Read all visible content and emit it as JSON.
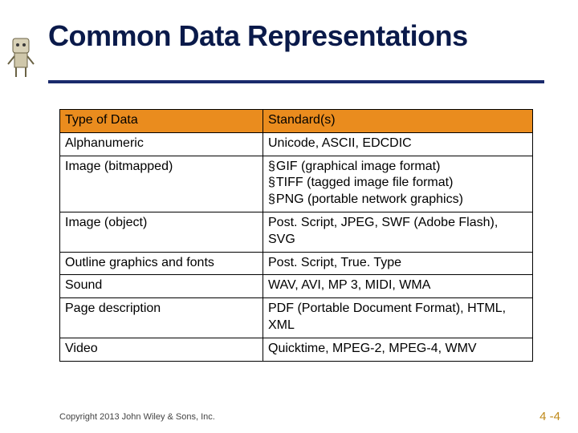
{
  "title": "Common Data Representations",
  "table": {
    "headers": {
      "col1": "Type of Data",
      "col2": "Standard(s)"
    },
    "rows": [
      {
        "type": "Alphanumeric",
        "std": "Unicode, ASCII, EDCDIC"
      },
      {
        "type": "Image (bitmapped)",
        "bullets": [
          "GIF (graphical image format)",
          "TIFF (tagged image file format)",
          "PNG (portable network graphics)"
        ]
      },
      {
        "type": "Image (object)",
        "std": "Post. Script, JPEG, SWF (Adobe Flash), SVG"
      },
      {
        "type": "Outline graphics and fonts",
        "std": "Post. Script, True. Type"
      },
      {
        "type": "Sound",
        "std": "WAV, AVI, MP 3, MIDI, WMA"
      },
      {
        "type": "Page description",
        "std": "PDF (Portable Document Format), HTML, XML"
      },
      {
        "type": "Video",
        "std": "Quicktime, MPEG-2, MPEG-4, WMV"
      }
    ]
  },
  "copyright": "Copyright 2013 John Wiley & Sons, Inc.",
  "page_number": "4 -4",
  "bullet_glyph": "§"
}
